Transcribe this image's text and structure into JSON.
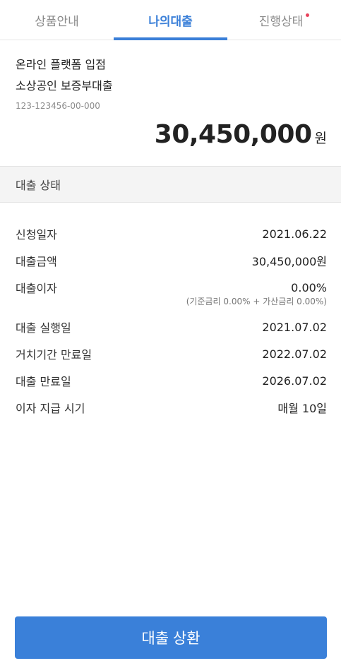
{
  "tabs": [
    {
      "label": "상품안내",
      "active": false,
      "has_dot": false
    },
    {
      "label": "나의대출",
      "active": true,
      "has_dot": false
    },
    {
      "label": "진행상태",
      "active": false,
      "has_dot": true
    }
  ],
  "product": {
    "line1": "온라인 플랫폼 입점",
    "line2": "소상공인 보증부대출",
    "account_no": "123-123456-00-000"
  },
  "loan_amount": {
    "value": "30,450,000",
    "unit": "원"
  },
  "section_title": "대출 상태",
  "details": {
    "apply_date": {
      "label": "신청일자",
      "value": "2021.06.22"
    },
    "loan_amount": {
      "label": "대출금액",
      "value": "30,450,000원"
    },
    "interest": {
      "label": "대출이자",
      "value": "0.00%",
      "note": "(기준금리 0.00% + 가산금리 0.00%)"
    },
    "exec_date": {
      "label": "대출 실행일",
      "value": "2021.07.02"
    },
    "grace_end": {
      "label": "거치기간 만료일",
      "value": "2022.07.02"
    },
    "maturity": {
      "label": "대출 만료일",
      "value": "2026.07.02"
    },
    "pay_day": {
      "label": "이자 지급 시기",
      "value": "매월 10일"
    }
  },
  "repay_button": "대출 상환",
  "colors": {
    "accent": "#3a7fd8",
    "dot": "#e8425c",
    "section_bg": "#f4f4f4"
  }
}
